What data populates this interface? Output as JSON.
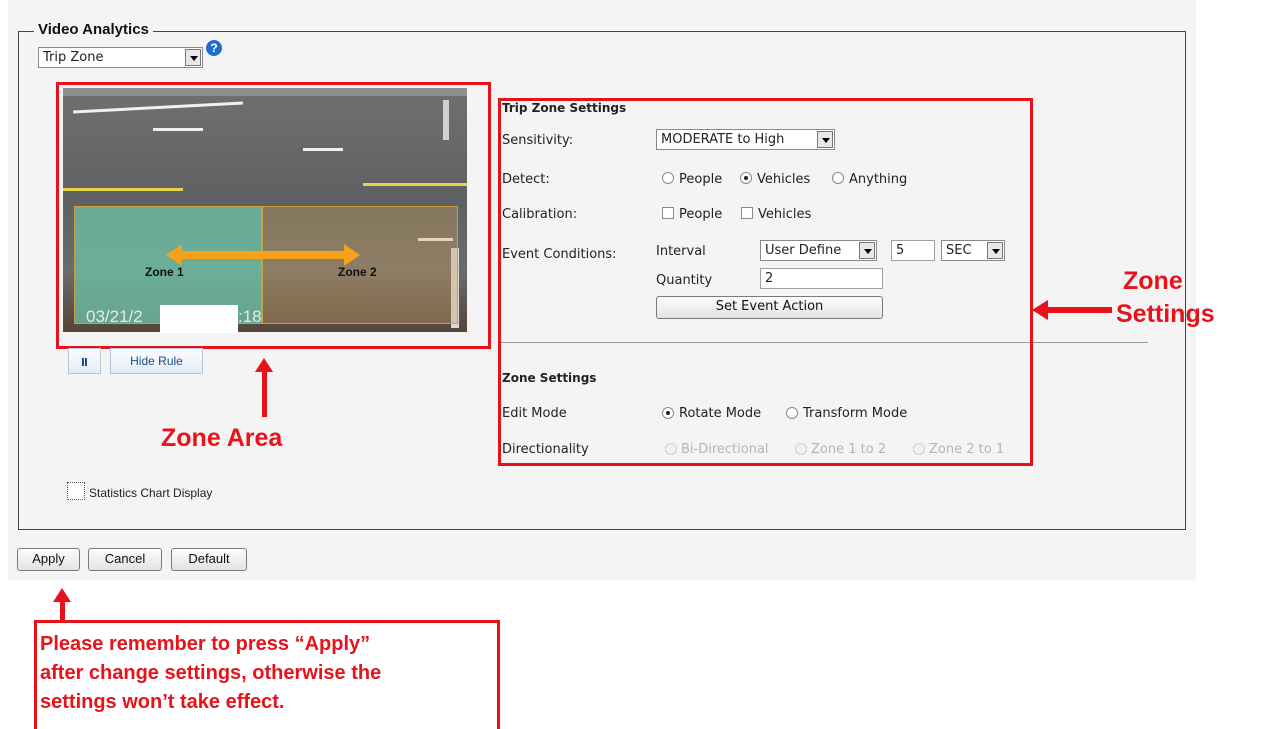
{
  "section": {
    "title": "Video Analytics",
    "mode_select": "Trip Zone"
  },
  "video": {
    "zone1_label": "Zone 1",
    "zone2_label": "Zone 2",
    "timestamp_date": "03/21/2",
    "timestamp_time": ":18",
    "pause_icon": "pause-icon",
    "hide_rule_label": "Hide Rule"
  },
  "statistics": {
    "label": "Statistics Chart Display",
    "checked": false
  },
  "trip_zone_settings": {
    "heading": "Trip Zone Settings",
    "sensitivity_label": "Sensitivity:",
    "sensitivity_value": "MODERATE to High",
    "detect_label": "Detect:",
    "detect_options": [
      "People",
      "Vehicles",
      "Anything"
    ],
    "detect_selected": "Vehicles",
    "calibration_label": "Calibration:",
    "calibration_options": [
      "People",
      "Vehicles"
    ],
    "event_conditions_label": "Event Conditions:",
    "interval_label": "Interval",
    "interval_mode": "User Define",
    "interval_value": "5",
    "interval_unit": "SEC",
    "quantity_label": "Quantity",
    "quantity_value": "2",
    "set_event_action_label": "Set Event Action"
  },
  "zone_settings": {
    "heading": "Zone Settings",
    "edit_mode_label": "Edit Mode",
    "edit_mode_options": [
      "Rotate Mode",
      "Transform Mode"
    ],
    "edit_mode_selected": "Rotate Mode",
    "directionality_label": "Directionality",
    "directionality_options": [
      "Bi-Directional",
      "Zone 1 to 2",
      "Zone 2 to 1"
    ]
  },
  "footer": {
    "apply_label": "Apply",
    "cancel_label": "Cancel",
    "default_label": "Default"
  },
  "annotations": {
    "zone_area": "Zone Area",
    "zone_settings_line1": "Zone",
    "zone_settings_line2": "Settings",
    "apply_note_line1": "Please remember to press “Apply”",
    "apply_note_line2": "after change settings, otherwise the",
    "apply_note_line3": "settings won’t take effect."
  },
  "colors": {
    "annotation_red": "#e8121b",
    "zone_arrow": "#f5a21a",
    "zone1_fill": "#6ec8aa",
    "help_icon": "#1e6fd0"
  }
}
